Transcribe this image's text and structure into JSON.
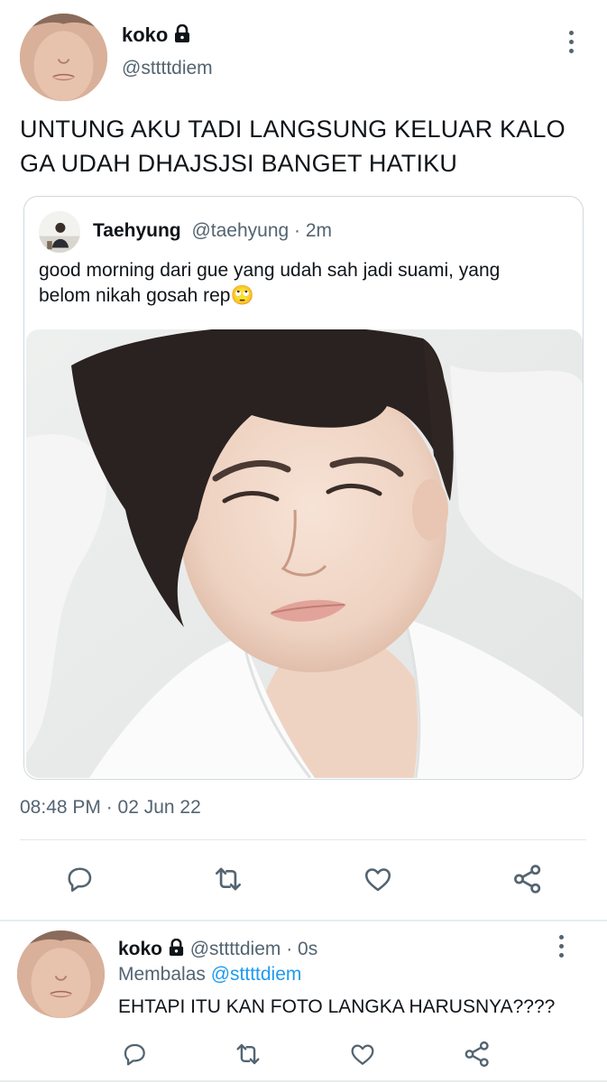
{
  "main_tweet": {
    "author_name": "koko",
    "author_handle": "@sttttdiem",
    "text_line1": "UNTUNG AKU TADI LANGSUNG KELUAR KALO",
    "text_line2": "GA UDAH DHAJSJSI BANGET HATIKU",
    "timestamp": "08:48 PM · 02 Jun 22"
  },
  "quoted_tweet": {
    "author_name": "Taehyung",
    "author_handle": "@taehyung",
    "time": "· 2m",
    "text_line1": "good morning dari gue yang udah sah jadi suami, yang",
    "text_line2": "belom nikah gosah rep",
    "emoji": "🙄"
  },
  "reply": {
    "author_name": "koko",
    "author_handle": "@sttttdiem",
    "time": "· 0s",
    "replying_label": "Membalas",
    "replying_to": "@sttttdiem",
    "text": "EHTAPI ITU KAN FOTO LANGKA HARUSNYA????"
  },
  "icons": {
    "reply": "comment-icon",
    "retweet": "retweet-icon",
    "like": "heart-icon",
    "share": "share-icon",
    "lock": "lock-icon",
    "more": "more-vertical-icon"
  },
  "colors": {
    "text": "#0f1419",
    "muted": "#536471",
    "link": "#1d9bf0",
    "border": "#cfd9de"
  }
}
